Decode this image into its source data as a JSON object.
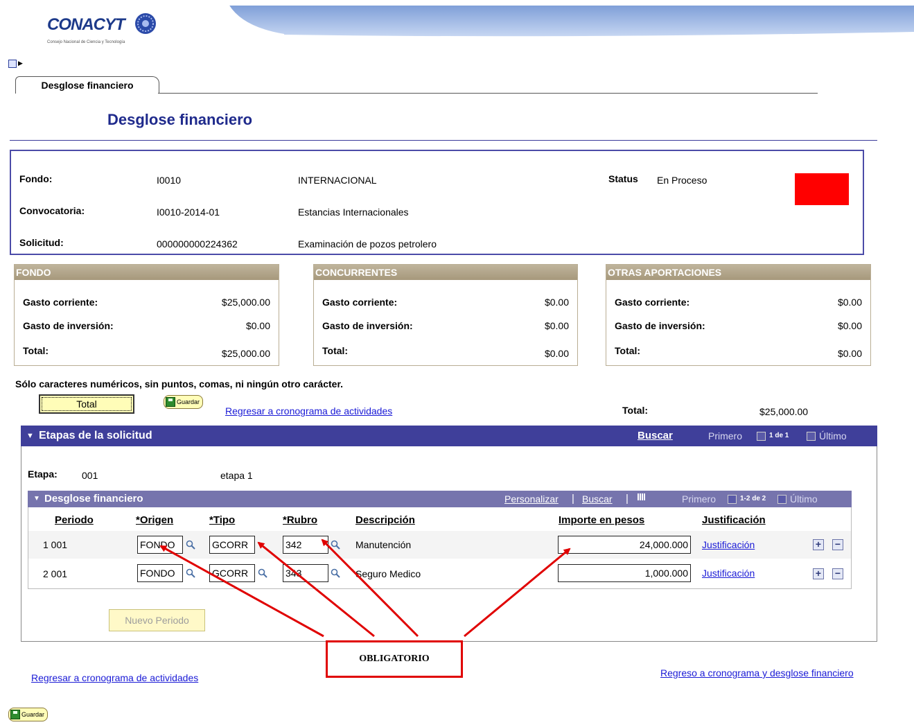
{
  "header": {
    "logo_text": "CONACYT",
    "logo_subtitle": "Consejo Nacional de Ciencia y Tecnología"
  },
  "tab": {
    "label": "Desglose financiero"
  },
  "page_title": "Desglose financiero",
  "info": {
    "fondo_label": "Fondo:",
    "fondo_code": "I0010",
    "fondo_name": "INTERNACIONAL",
    "status_label": "Status",
    "status_value": "En Proceso",
    "convocatoria_label": "Convocatoria:",
    "convocatoria_code": "I0010-2014-01",
    "convocatoria_name": "Estancias Internacionales",
    "solicitud_label": "Solicitud:",
    "solicitud_code": "000000000224362",
    "solicitud_name": "Examinación de pozos petrolero",
    "status_color": "#ff0000"
  },
  "funds": [
    {
      "title": "FONDO",
      "corriente_label": "Gasto corriente:",
      "corriente": "$25,000.00",
      "inversion_label": "Gasto de inversión:",
      "inversion": "$0.00",
      "total_label": "Total:",
      "total": "$25,000.00"
    },
    {
      "title": "CONCURRENTES",
      "corriente_label": "Gasto corriente:",
      "corriente": "$0.00",
      "inversion_label": "Gasto de inversión:",
      "inversion": "$0.00",
      "total_label": "Total:",
      "total": "$0.00"
    },
    {
      "title": "OTRAS APORTACIONES",
      "corriente_label": "Gasto corriente:",
      "corriente": "$0.00",
      "inversion_label": "Gasto de inversión:",
      "inversion": "$0.00",
      "total_label": "Total:",
      "total": "$0.00"
    }
  ],
  "note": "Sólo caracteres numéricos, sin puntos, comas, ni ningún otro carácter.",
  "actions": {
    "total_button": "Total",
    "guardar": "Guardar",
    "regresar_link": "Regresar a cronograma de actividades",
    "grand_total_label": "Total:",
    "grand_total_value": "$25,000.00"
  },
  "etapas": {
    "title": "Etapas de la solicitud",
    "buscar": "Buscar",
    "primero": "Primero",
    "counter": "1 de 1",
    "ultimo": "Último",
    "etapa_label": "Etapa:",
    "etapa_code": "001",
    "etapa_name": "etapa 1"
  },
  "desglose": {
    "title": "Desglose financiero",
    "personalizar": "Personalizar",
    "buscar": "Buscar",
    "primero": "Primero",
    "counter": "1-2 de 2",
    "ultimo": "Último",
    "columns": [
      "Periodo",
      "*Origen",
      "*Tipo",
      "*Rubro",
      "Descripción",
      "Importe en pesos",
      "Justificación"
    ],
    "rows": [
      {
        "periodo": "1 001",
        "origen": "FONDO",
        "tipo": "GCORR",
        "rubro": "342",
        "descripcion": "Manutención",
        "importe": "24,000.000",
        "justificacion": "Justificación"
      },
      {
        "periodo": "2 001",
        "origen": "FONDO",
        "tipo": "GCORR",
        "rubro": "343",
        "descripcion": "Seguro Medico",
        "importe": "1,000.000",
        "justificacion": "Justificación"
      }
    ],
    "nuevo_periodo": "Nuevo Periodo"
  },
  "annotation": {
    "label": "OBLIGATORIO",
    "color": "#e00000"
  },
  "footer": {
    "regresar_link": "Regresar a cronograma de actividades",
    "regreso_link": "Regreso a cronograma y desglose financiero",
    "guardar": "Guardar"
  }
}
